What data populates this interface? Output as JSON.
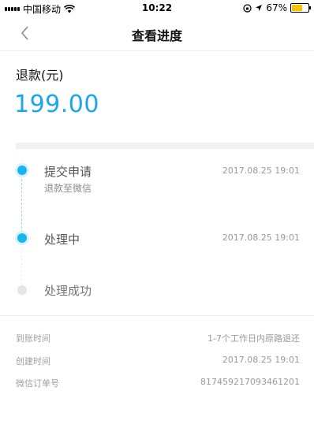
{
  "status_bar": {
    "carrier": "中国移动",
    "time": "10:22",
    "battery": "67%",
    "battery_level": 0.67,
    "battery_color": "#f5c400"
  },
  "nav": {
    "title": "查看进度",
    "back_icon": "chevron-left-icon"
  },
  "refund": {
    "label": "退款(元)",
    "amount": "199.00",
    "amount_color": "#1aa6ea"
  },
  "timeline": {
    "accent_color": "#18b5f0",
    "steps": [
      {
        "title": "提交申请",
        "subtitle": "退款至微信",
        "time": "2017.08.25 19:01",
        "state": "done"
      },
      {
        "title": "处理中",
        "subtitle": "",
        "time": "2017.08.25 19:01",
        "state": "done"
      },
      {
        "title": "处理成功",
        "subtitle": "",
        "time": "",
        "state": "pending"
      }
    ]
  },
  "info": [
    {
      "label": "到账时间",
      "value": "1-7个工作日内原路退还"
    },
    {
      "label": "创建时间",
      "value": "2017.08.25 19:01"
    },
    {
      "label": "微信订单号",
      "value": "8174592170934612​01"
    }
  ]
}
